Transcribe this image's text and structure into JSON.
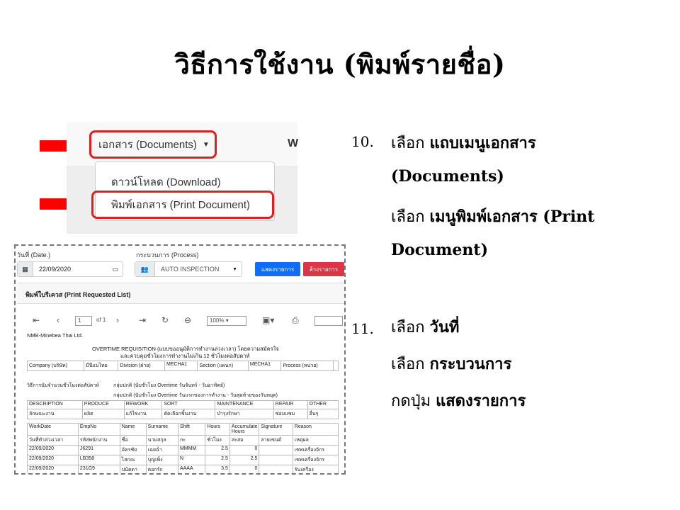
{
  "title": "วิธีการใช้งาน (พิมพ์รายชื่อ)",
  "menu_shot": {
    "documents_menu": "เอกสาร (Documents)",
    "next_menu_initial": "W",
    "download_item": "ดาวน์โหลด (Download)",
    "print_item": "พิมพ์เอกสาร (Print Document)"
  },
  "steps": [
    {
      "num": "10.",
      "lines": [
        {
          "plain": "เลือก ",
          "bold": "แถบเมนูเอกสาร"
        },
        {
          "plain": "",
          "bold": "(Documents)"
        },
        {
          "plain": "เลือก ",
          "bold": "เมนูพิมพ์เอกสาร (Print"
        },
        {
          "plain": "",
          "bold": "Document)"
        }
      ]
    },
    {
      "num": "11.",
      "lines": [
        {
          "plain": "เลือก ",
          "bold": "วันที่"
        },
        {
          "plain": "เลือก ",
          "bold": "กระบวนการ"
        },
        {
          "plain": "กดปุ่ม ",
          "bold": "แสดงรายการ"
        }
      ]
    }
  ],
  "report_shot": {
    "date_label": "วันที่ (Date.)",
    "date_value": "22/09/2020",
    "process_label": "กระบวนการ (Process)",
    "process_value": "AUTO INSPECTION",
    "show_button": "แสดงรายการ",
    "clear_button": "ล้างรายการ",
    "panel_title": "พิมพ์ใบรีเควส (Print Requested List)",
    "page_current": "1",
    "page_of": "of 1",
    "zoom": "100%",
    "company": "NMB-Minebea Thai Ltd.",
    "report_title": "OVERTIME REQUISITION (แบบขออนุมัติการทำงานล่วงเวลา) โดยความสมัครใจ",
    "report_subtitle": "และควบคุมชั่วโมงการทำงานไม่เกิน 12 ชั่วโมงต่อสัปดาห์",
    "info_row": [
      "Company (บริษัท)",
      "มีนีแบไทย",
      "Division (ฝ่าย)",
      "MECHA1",
      "Section (แผนก)",
      "MECHA1",
      "Process (หน่วย)",
      ""
    ],
    "method_label": "วิธีการนับจำนวนชั่วโมงต่อสัปดาห์",
    "method_1": "กลุ่มปกติ (นับชั่วโมง Overtime วันจันทร์ - วันอาทิตย์)",
    "method_2": "กลุ่มปกติ (นับชั่วโมง Overtime วันแรกของการทำงาน - วันสุดท้ายของวันหยุด)",
    "desc_headers": [
      "DESCRIPTION",
      "PRODUCE",
      "REWORK",
      "SORT",
      "MAINTENANCE",
      "REPAIR",
      "OTHER"
    ],
    "desc_values": [
      "ลักษณะงาน",
      "ผลิต",
      "แก้ไขงาน",
      "คัดเลือกชิ้นงาน",
      "บำรุงรักษา",
      "ซ่อมแซม",
      "อื่นๆ"
    ],
    "columns": [
      "WorkDate",
      "EmpNo",
      "Name",
      "Surname",
      "Shift",
      "Hours",
      "Accumulate Hours",
      "Signature",
      "Reason"
    ],
    "columns_th": [
      "วันที่ทำล่วงเวลา",
      "รหัสพนักงาน",
      "ชื่อ",
      "นามสกุล",
      "กะ",
      "ชั่วโมง",
      "สะสม",
      "ลายเซนต์",
      "เหตุผล"
    ],
    "rows": [
      [
        "22/09/2020",
        "J6291",
        "อัครชัย",
        "เฉยฉ่ำ",
        "MMMM",
        "2.5",
        "0",
        "",
        "เซทเครื่องจักร"
      ],
      [
        "22/09/2020",
        "LB358",
        "ไสกณ",
        "บุญเพ็ง",
        "N",
        "2.5",
        "2.5",
        "",
        "เซทเครื่องจักร"
      ],
      [
        "22/09/2020",
        "231G9",
        "ปนัดดา",
        "ดอกรัก",
        "AAAA",
        "3.5",
        "0",
        "",
        "รันเครื่อง"
      ]
    ]
  },
  "colors": {
    "highlight": "#e02020",
    "primary": "#0d6efd",
    "danger": "#dc3545",
    "arrow": "#ff0000"
  }
}
